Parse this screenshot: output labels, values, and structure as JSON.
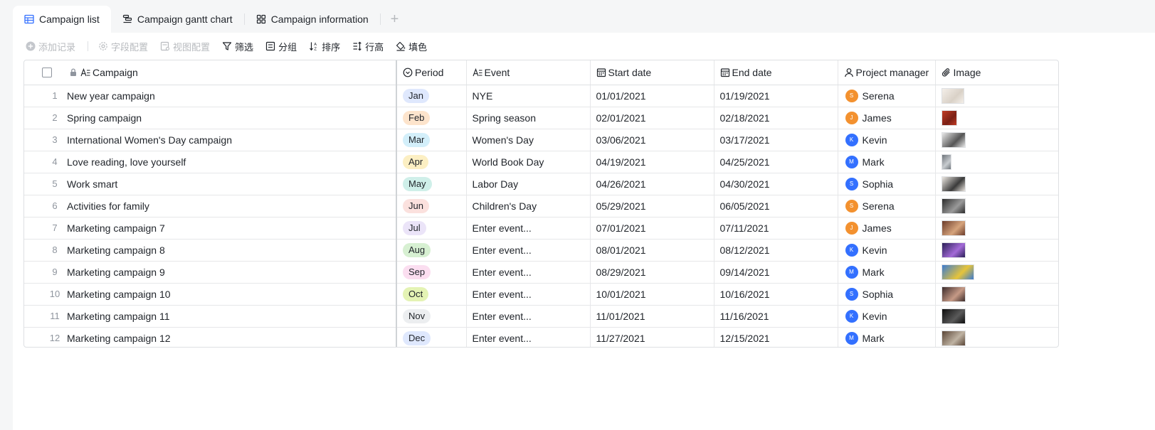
{
  "tabs": [
    {
      "label": "Campaign list",
      "icon": "table-icon",
      "active": true
    },
    {
      "label": "Campaign gantt chart",
      "icon": "gantt-icon",
      "active": false
    },
    {
      "label": "Campaign information",
      "icon": "grid-icon",
      "active": false
    }
  ],
  "tab_add": "+",
  "toolbar": {
    "add_record": "添加记录",
    "field_config": "字段配置",
    "view_config": "视图配置",
    "filter": "筛选",
    "group": "分组",
    "sort": "排序",
    "row_height": "行高",
    "fill_color": "填色"
  },
  "columns": {
    "campaign": "Campaign",
    "period": "Period",
    "event": "Event",
    "start_date": "Start date",
    "end_date": "End date",
    "project_manager": "Project manager",
    "image": "Image"
  },
  "colors": {
    "orange_avatar": "#f3912f",
    "blue_avatar": "#3370ff"
  },
  "rows": [
    {
      "index": "1",
      "campaign": "New year campaign",
      "period": "Jan",
      "period_color": "#dfe8fd",
      "event": "NYE",
      "start": "01/01/2021",
      "end": "01/19/2021",
      "pm": "Serena",
      "pm_initial": "S",
      "pm_color": "#f3912f",
      "thumb_colors": [
        "#f4efe9",
        "#d9d1c7"
      ],
      "thumb_w": 32
    },
    {
      "index": "2",
      "campaign": "Spring campaign",
      "period": "Feb",
      "period_color": "#fde4cc",
      "event": "Spring season",
      "start": "02/01/2021",
      "end": "02/18/2021",
      "pm": "James",
      "pm_initial": "J",
      "pm_color": "#f3912f",
      "thumb_colors": [
        "#c13b24",
        "#7a2015"
      ],
      "thumb_w": 22
    },
    {
      "index": "3",
      "campaign": "International Women's Day campaign",
      "period": "Mar",
      "period_color": "#d3effa",
      "event": "Women's Day",
      "start": "03/06/2021",
      "end": "03/17/2021",
      "pm": "Kevin",
      "pm_initial": "K",
      "pm_color": "#3370ff",
      "thumb_colors": [
        "#e9e9e9",
        "#555555"
      ],
      "thumb_w": 34
    },
    {
      "index": "4",
      "campaign": "Love reading, love yourself",
      "period": "Apr",
      "period_color": "#fcefc3",
      "event": "World Book Day",
      "start": "04/19/2021",
      "end": "04/25/2021",
      "pm": "Mark",
      "pm_initial": "M",
      "pm_color": "#3370ff",
      "thumb_colors": [
        "#6d7379",
        "#c8ccd0"
      ],
      "thumb_w": 14
    },
    {
      "index": "5",
      "campaign": "Work smart",
      "period": "May",
      "period_color": "#cfefe9",
      "event": "Labor Day",
      "start": "04/26/2021",
      "end": "04/30/2021",
      "pm": "Sophia",
      "pm_initial": "S",
      "pm_color": "#3370ff",
      "thumb_colors": [
        "#ece7e1",
        "#3a3a3a"
      ],
      "thumb_w": 34
    },
    {
      "index": "6",
      "campaign": "Activities for family",
      "period": "Jun",
      "period_color": "#fbe1de",
      "event": "Children's Day",
      "start": "05/29/2021",
      "end": "06/05/2021",
      "pm": "Serena",
      "pm_initial": "S",
      "pm_color": "#f3912f",
      "thumb_colors": [
        "#2b2b2b",
        "#9a9a9a"
      ],
      "thumb_w": 34
    },
    {
      "index": "7",
      "campaign": "Marketing campaign 7",
      "period": "Jul",
      "period_color": "#ebe4f8",
      "event": "Enter event...",
      "start": "07/01/2021",
      "end": "07/11/2021",
      "pm": "James",
      "pm_initial": "J",
      "pm_color": "#f3912f",
      "thumb_colors": [
        "#6b3b2a",
        "#d6a47c"
      ],
      "thumb_w": 34
    },
    {
      "index": "8",
      "campaign": "Marketing campaign 8",
      "period": "Aug",
      "period_color": "#d7f0d2",
      "event": "Enter event...",
      "start": "08/01/2021",
      "end": "08/12/2021",
      "pm": "Kevin",
      "pm_initial": "K",
      "pm_color": "#3370ff",
      "thumb_colors": [
        "#2a1f57",
        "#a46bd8"
      ],
      "thumb_w": 34
    },
    {
      "index": "9",
      "campaign": "Marketing campaign 9",
      "period": "Sep",
      "period_color": "#fbdef0",
      "event": "Enter event...",
      "start": "08/29/2021",
      "end": "09/14/2021",
      "pm": "Mark",
      "pm_initial": "M",
      "pm_color": "#3370ff",
      "thumb_colors": [
        "#3b7bd0",
        "#e6c43a"
      ],
      "thumb_w": 46
    },
    {
      "index": "10",
      "campaign": "Marketing campaign 10",
      "period": "Oct",
      "period_color": "#e4f3b4",
      "event": "Enter event...",
      "start": "10/01/2021",
      "end": "10/16/2021",
      "pm": "Sophia",
      "pm_initial": "S",
      "pm_color": "#3370ff",
      "thumb_colors": [
        "#3c2b2b",
        "#c69a86"
      ],
      "thumb_w": 34
    },
    {
      "index": "11",
      "campaign": "Marketing campaign 11",
      "period": "Nov",
      "period_color": "#eceef0",
      "event": "Enter event...",
      "start": "11/01/2021",
      "end": "11/16/2021",
      "pm": "Kevin",
      "pm_initial": "K",
      "pm_color": "#3370ff",
      "thumb_colors": [
        "#0d0d0d",
        "#5a5a5a"
      ],
      "thumb_w": 34
    },
    {
      "index": "12",
      "campaign": "Marketing campaign 12",
      "period": "Dec",
      "period_color": "#dfe8fd",
      "event": "Enter event...",
      "start": "11/27/2021",
      "end": "12/15/2021",
      "pm": "Mark",
      "pm_initial": "M",
      "pm_color": "#3370ff",
      "thumb_colors": [
        "#5a4536",
        "#bfb3a3"
      ],
      "thumb_w": 34
    }
  ]
}
